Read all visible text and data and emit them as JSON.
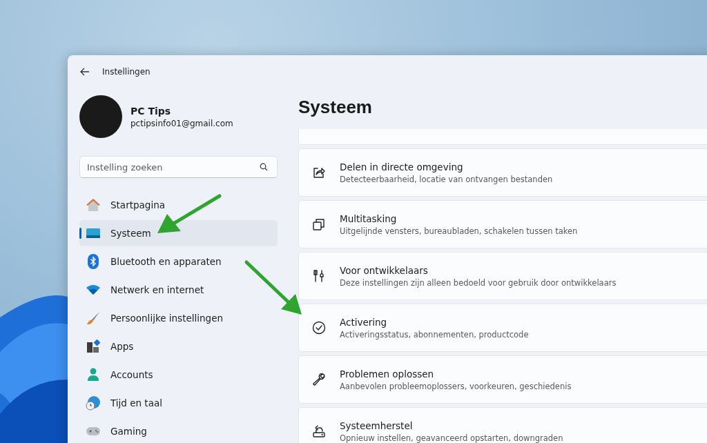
{
  "window": {
    "title": "Instellingen"
  },
  "account": {
    "name": "PC Tips",
    "email": "pctipsinfo01@gmail.com"
  },
  "search": {
    "placeholder": "Instelling zoeken"
  },
  "sidebar": {
    "items": [
      {
        "label": "Startpagina",
        "selected": false
      },
      {
        "label": "Systeem",
        "selected": true
      },
      {
        "label": "Bluetooth en apparaten",
        "selected": false
      },
      {
        "label": "Netwerk en internet",
        "selected": false
      },
      {
        "label": "Persoonlijke instellingen",
        "selected": false
      },
      {
        "label": "Apps",
        "selected": false
      },
      {
        "label": "Accounts",
        "selected": false
      },
      {
        "label": "Tijd en taal",
        "selected": false
      },
      {
        "label": "Gaming",
        "selected": false
      }
    ]
  },
  "page": {
    "title": "Systeem",
    "cards": [
      {
        "title": "Delen in directe omgeving",
        "subtitle": "Detecteerbaarheid, locatie van ontvangen bestanden"
      },
      {
        "title": "Multitasking",
        "subtitle": "Uitgelijnde vensters, bureaubladen, schakelen tussen taken"
      },
      {
        "title": "Voor ontwikkelaars",
        "subtitle": "Deze instellingen zijn alleen bedoeld voor gebruik door ontwikkelaars"
      },
      {
        "title": "Activering",
        "subtitle": "Activeringsstatus, abonnementen, productcode"
      },
      {
        "title": "Problemen oplossen",
        "subtitle": "Aanbevolen probleemoplossers, voorkeuren, geschiedenis"
      },
      {
        "title": "Systeemherstel",
        "subtitle": "Opnieuw instellen, geavanceerd opstarten, downgraden"
      }
    ]
  }
}
